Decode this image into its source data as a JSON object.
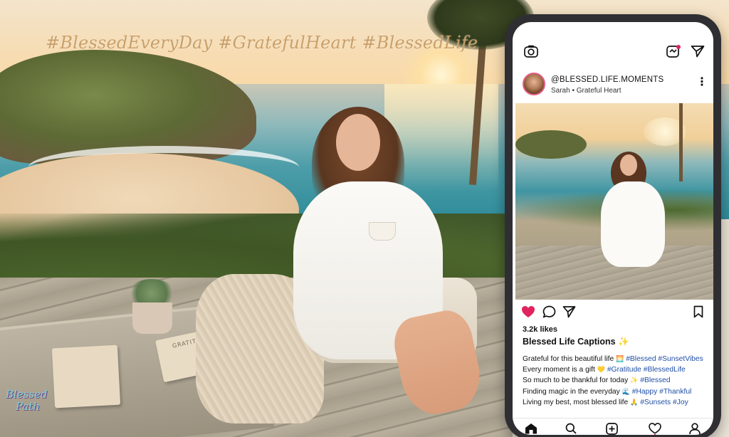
{
  "hashtags": "#BlessedEveryDay #GratefulHeart #BlessedLife",
  "watermark": {
    "line1": "Blessed",
    "line2": "Path"
  },
  "scene": {
    "notebook_label": "GRATITUDE"
  },
  "instagram": {
    "icons": {
      "camera": "camera-icon",
      "messenger": "messenger-icon",
      "send": "send-icon",
      "more": "more-icon"
    },
    "post": {
      "username": "@BLESSED.LIFE.MOMENTS",
      "subtitle": "Sarah • Grateful Heart",
      "likes": "3.2k likes",
      "caption_title": "Blessed Life Captions",
      "caption_title_emoji": "✨",
      "caption_lines": [
        {
          "text": "Grateful for this beautiful life",
          "emoji": "🌅",
          "tags": "#Blessed #SunsetVibes"
        },
        {
          "text": "Every moment is a gift",
          "emoji": "💛",
          "tags": "#Gratitude #BlessedLife"
        },
        {
          "text": "So much to be thankful for today",
          "emoji": "✨",
          "tags": "#Blessed"
        },
        {
          "text": "Finding magic in the everyday",
          "emoji": "🌊",
          "tags": "#Happy #Thankful"
        },
        {
          "text": "Living my best, most blessed life",
          "emoji": "🙏",
          "tags": "#Sunsets #Joy"
        }
      ]
    },
    "colors": {
      "like": "#e0245e",
      "hashtag": "#1f4fa6",
      "hashtag_overlay": "#c9a06a"
    }
  }
}
